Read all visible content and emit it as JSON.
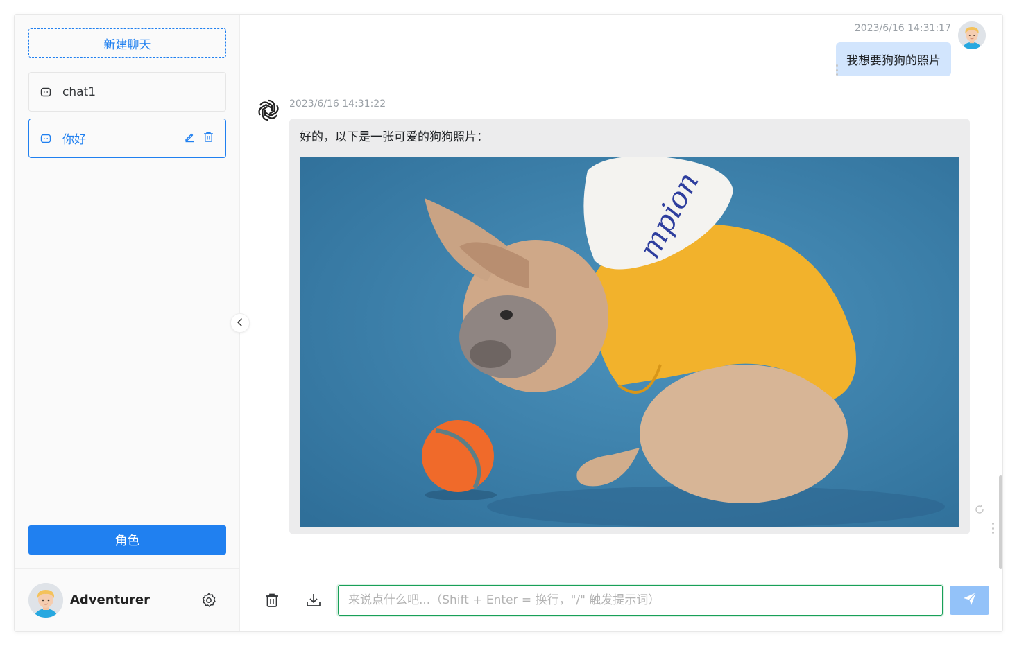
{
  "sidebar": {
    "new_chat_label": "新建聊天",
    "chats": [
      {
        "label": "chat1",
        "active": false
      },
      {
        "label": "你好",
        "active": true
      }
    ],
    "role_button_label": "角色",
    "user": {
      "name": "Adventurer"
    }
  },
  "messages": [
    {
      "role": "user",
      "time": "2023/6/16 14:31:17",
      "text": "我想要狗狗的照片"
    },
    {
      "role": "assistant",
      "time": "2023/6/16 14:31:22",
      "text": "好的，以下是一张可爱的狗狗照片："
    }
  ],
  "composer": {
    "placeholder": "来说点什么吧...（Shift + Enter = 换行，\"/\" 触发提示词）"
  },
  "colors": {
    "accent": "#2080f0",
    "input_border": "#18a058",
    "user_bubble": "#d2e5fd",
    "bot_bubble": "#ececed",
    "send_button": "#93c2f9"
  },
  "icons": [
    "chat-icon",
    "edit-icon",
    "trash-icon",
    "gear-icon",
    "chevron-left-icon",
    "openai-icon",
    "download-icon",
    "send-icon",
    "refresh-icon",
    "more-vertical-icon"
  ]
}
